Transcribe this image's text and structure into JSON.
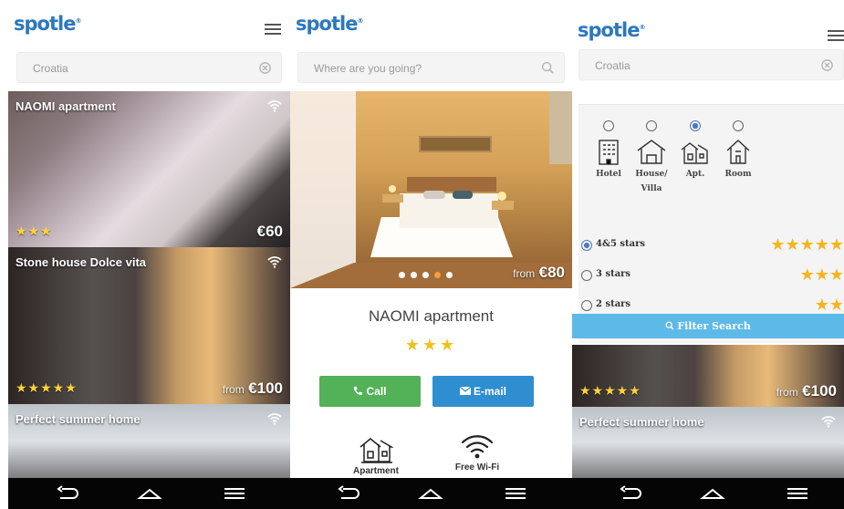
{
  "brand": {
    "logo_text": "spotle",
    "accent_color": "#2b78bd"
  },
  "screen1": {
    "search_value": "Croatia",
    "clear_icon": "clear-icon",
    "listings": [
      {
        "title": "NAOMI apartment",
        "stars": "★★★",
        "price_text": "€60"
      },
      {
        "title": "Stone house Dolce vita",
        "stars": "★★★★★",
        "price_from": "from",
        "price": "€100"
      },
      {
        "title": "Perfect summer home"
      }
    ]
  },
  "screen2": {
    "search_placeholder": "Where are you going?",
    "price_from": "from",
    "price": "€80",
    "title": "NAOMI apartment",
    "stars": "★★★",
    "call_label": "Call",
    "email_label": "E-mail",
    "features": [
      "Apartment",
      "Free Wi-Fi"
    ]
  },
  "screen3": {
    "search_value": "Croatia",
    "types": [
      {
        "label": "Hotel",
        "selected": false
      },
      {
        "label": "House/ Villa",
        "selected": false
      },
      {
        "label": "Apt.",
        "selected": true
      },
      {
        "label": "Room",
        "selected": false
      }
    ],
    "ratings": [
      {
        "label": "4&5 stars",
        "stars": "★★★★★",
        "selected": true
      },
      {
        "label": "3 stars",
        "stars": "★★★",
        "selected": false
      },
      {
        "label": "2 stars",
        "stars": "★★",
        "selected": false
      }
    ],
    "filter_button": "Filter Search",
    "listings": [
      {
        "stars": "★★★★★",
        "price_from": "from",
        "price": "€100"
      },
      {
        "title": "Perfect summer home"
      }
    ]
  },
  "nav": {
    "icons": [
      "back-icon",
      "home-icon",
      "menu-icon"
    ]
  }
}
